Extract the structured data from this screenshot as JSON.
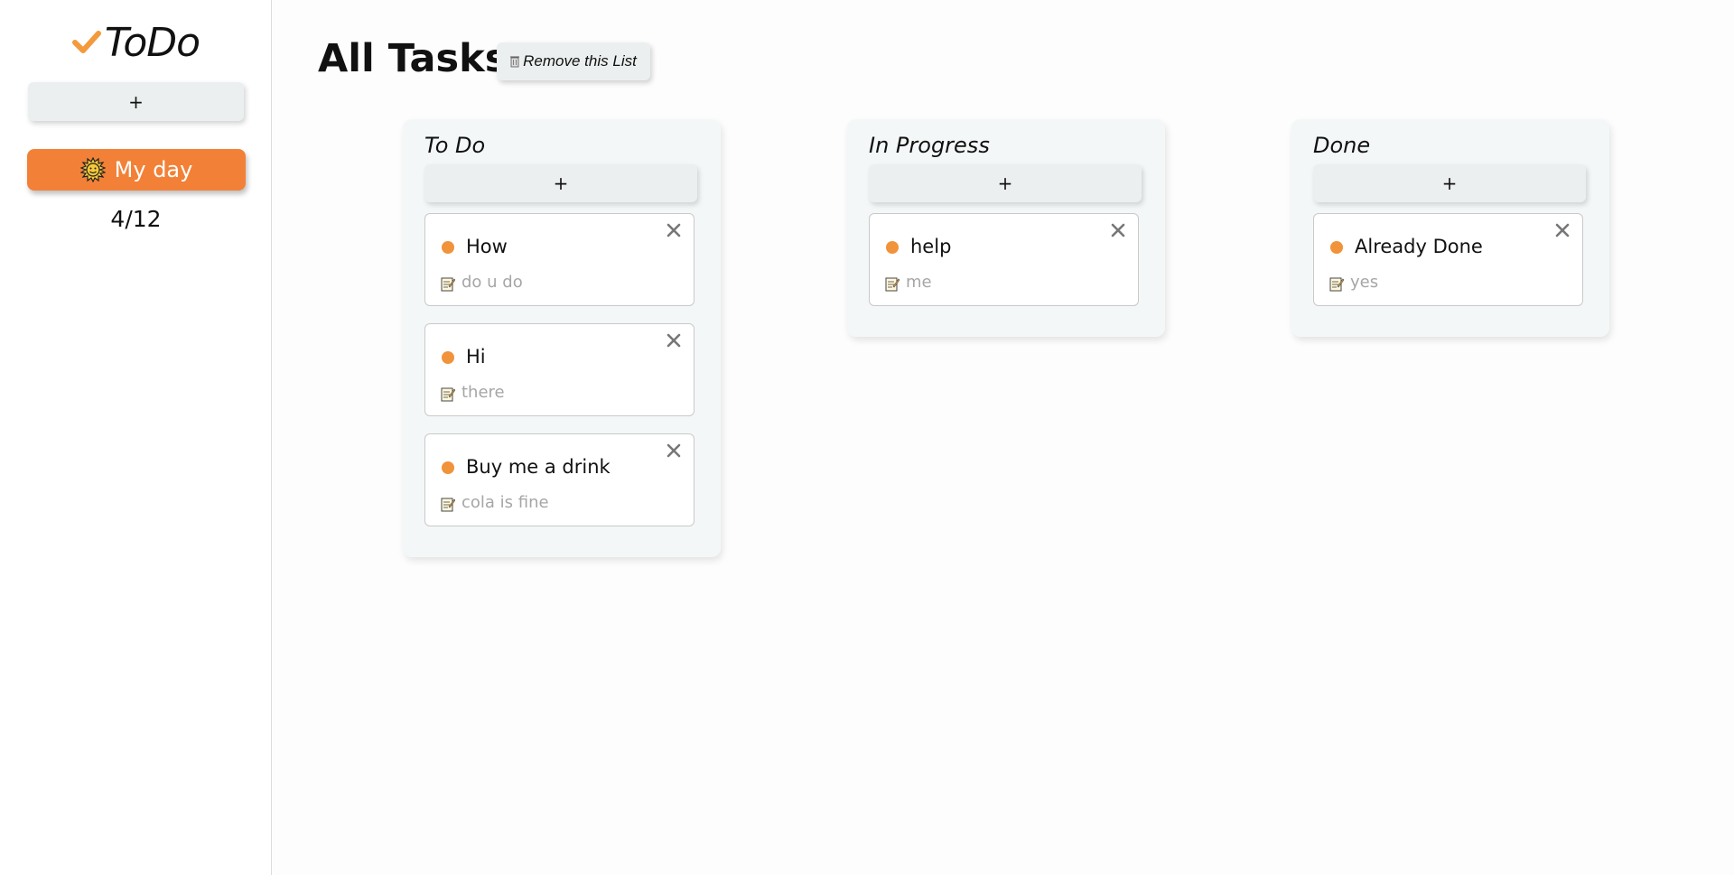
{
  "app": {
    "logo_text": "ToDo"
  },
  "sidebar": {
    "add_label": "+",
    "items": [
      {
        "label": "My day",
        "count": "4/12"
      }
    ]
  },
  "main": {
    "title": "All Tasks",
    "remove_label": "Remove this List",
    "columns": [
      {
        "title": "To Do",
        "add_label": "+",
        "cards": [
          {
            "title": "How",
            "description": "do u do"
          },
          {
            "title": "Hi",
            "description": "there"
          },
          {
            "title": "Buy me a drink",
            "description": "cola is fine"
          }
        ]
      },
      {
        "title": "In Progress",
        "add_label": "+",
        "cards": [
          {
            "title": "help",
            "description": "me"
          }
        ]
      },
      {
        "title": "Done",
        "add_label": "+",
        "cards": [
          {
            "title": "Already Done",
            "description": "yes"
          }
        ]
      }
    ]
  },
  "colors": {
    "accent": "#f28137",
    "dot": "#f0933a",
    "button_bg": "#ecefef",
    "column_bg": "#f4f7f8"
  },
  "icons": [
    "check-icon",
    "sun-icon",
    "trash-icon",
    "note-icon",
    "close-icon"
  ]
}
